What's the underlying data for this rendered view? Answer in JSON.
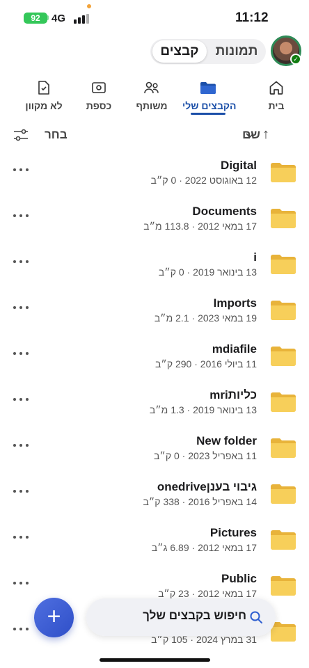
{
  "status": {
    "battery": "92",
    "network": "4G",
    "time": "11:12"
  },
  "header": {
    "toggle_photos": "תמונות",
    "toggle_files": "קבצים"
  },
  "tabs": [
    {
      "label": "בית",
      "icon": "home-icon"
    },
    {
      "label": "הקבצים שלי",
      "icon": "folder-icon",
      "active": true
    },
    {
      "label": "משותף",
      "icon": "people-icon"
    },
    {
      "label": "כספת",
      "icon": "vault-icon"
    },
    {
      "label": "לא מקוון",
      "icon": "offline-icon"
    }
  ],
  "sort": {
    "label": "שם",
    "select_label": "בחר"
  },
  "files": [
    {
      "name": "Digital",
      "meta": "12 באוגוסט 2022 · 0 ק״ב"
    },
    {
      "name": "Documents",
      "meta": "17 במאי 2012 · 113.8 מ״ב"
    },
    {
      "name": "i",
      "meta": "13 בינואר 2019 · 0 ק״ב"
    },
    {
      "name": "Imports",
      "meta": "19 במאי 2023 · 2.1 מ״ב"
    },
    {
      "name": "mdiafile",
      "meta": "11 ביולי 2016 · 290 ק״ב"
    },
    {
      "name": "כליותmri",
      "meta": "13 בינואר 2019 · 1.3 מ״ב"
    },
    {
      "name": "New folder",
      "meta": "11 באפריל 2023 · 0 ק״ב"
    },
    {
      "name": "גיבוי בענןonedrive",
      "meta": "14 באפריל 2016 · 338 ק״ב"
    },
    {
      "name": "Pictures",
      "meta": "17 במאי 2012 · 6.89 ג״ב"
    },
    {
      "name": "Public",
      "meta": "17 במאי 2012 · 23 ק״ב"
    },
    {
      "name": "",
      "meta": "31 במרץ 2024 · 105 ק״ב"
    }
  ],
  "search": {
    "label": "חיפוש בקבצים שלך"
  },
  "fab": {
    "label": "+"
  },
  "colors": {
    "accent": "#1b4fa8",
    "folder": "#f5c542",
    "badge": "#34c759"
  }
}
